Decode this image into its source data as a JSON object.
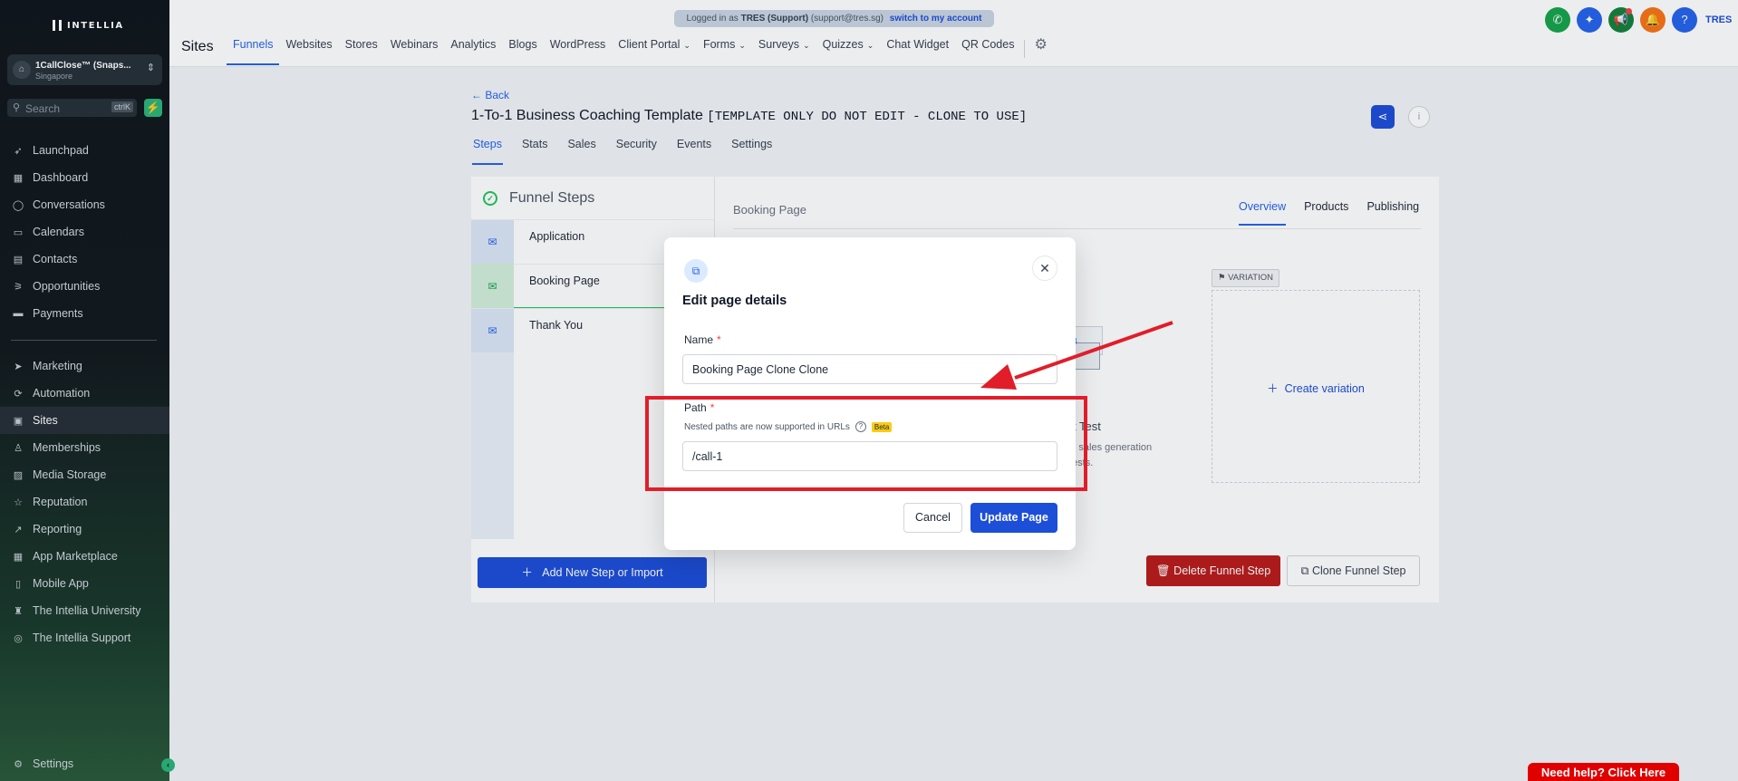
{
  "app": {
    "brand": "INTELLIA",
    "login_banner": {
      "prefix": "Logged in as",
      "user": "TRES (Support)",
      "email": "(support@tres.sg)",
      "switch_link": "switch to my account"
    }
  },
  "sidebar": {
    "account": {
      "name": "1CallClose™ (Snaps...",
      "location": "Singapore"
    },
    "search": {
      "placeholder": "Search",
      "shortcut": "ctrlK"
    },
    "items": [
      {
        "label": "Launchpad",
        "icon": "rocket-icon"
      },
      {
        "label": "Dashboard",
        "icon": "grid-icon"
      },
      {
        "label": "Conversations",
        "icon": "chat-icon"
      },
      {
        "label": "Calendars",
        "icon": "calendar-icon"
      },
      {
        "label": "Contacts",
        "icon": "contacts-icon"
      },
      {
        "label": "Opportunities",
        "icon": "filter-icon"
      },
      {
        "label": "Payments",
        "icon": "card-icon"
      }
    ],
    "items2": [
      {
        "label": "Marketing",
        "icon": "send-icon"
      },
      {
        "label": "Automation",
        "icon": "automation-icon"
      },
      {
        "label": "Sites",
        "icon": "globe-icon",
        "active": true
      },
      {
        "label": "Memberships",
        "icon": "membership-icon"
      },
      {
        "label": "Media Storage",
        "icon": "image-icon"
      },
      {
        "label": "Reputation",
        "icon": "star-icon"
      },
      {
        "label": "Reporting",
        "icon": "chart-icon"
      },
      {
        "label": "App Marketplace",
        "icon": "apps-icon"
      },
      {
        "label": "Mobile App",
        "icon": "phone-icon"
      },
      {
        "label": "The Intellia University",
        "icon": "graduation-icon"
      },
      {
        "label": "The Intellia Support",
        "icon": "support-icon"
      }
    ],
    "settings_label": "Settings"
  },
  "topbar": {
    "section_title": "Sites",
    "nav": [
      {
        "label": "Funnels",
        "active": true
      },
      {
        "label": "Websites"
      },
      {
        "label": "Stores"
      },
      {
        "label": "Webinars"
      },
      {
        "label": "Analytics"
      },
      {
        "label": "Blogs"
      },
      {
        "label": "WordPress"
      },
      {
        "label": "Client Portal",
        "dropdown": true
      },
      {
        "label": "Forms",
        "dropdown": true
      },
      {
        "label": "Surveys",
        "dropdown": true
      },
      {
        "label": "Quizzes",
        "dropdown": true
      },
      {
        "label": "Chat Widget"
      },
      {
        "label": "QR Codes"
      }
    ],
    "user_initials": "TRES",
    "icon_colors": {
      "phone": "#16a34a",
      "magic": "#2563eb",
      "announce": "#16a34a",
      "bell": "#f97316",
      "help": "#2563eb"
    }
  },
  "page": {
    "back_label": "Back",
    "title": "1-To-1 Business Coaching Template",
    "title_tag": "[TEMPLATE ONLY DO NOT EDIT - CLONE TO USE]",
    "tabs": [
      {
        "label": "Steps",
        "active": true
      },
      {
        "label": "Stats"
      },
      {
        "label": "Sales"
      },
      {
        "label": "Security"
      },
      {
        "label": "Events"
      },
      {
        "label": "Settings"
      }
    ]
  },
  "funnel_steps": {
    "header": "Funnel Steps",
    "steps": [
      {
        "label": "Application"
      },
      {
        "label": "Booking Page",
        "active": true
      },
      {
        "label": "Thank You"
      }
    ],
    "add_button": "Add New Step or Import"
  },
  "step_panel": {
    "title": "Booking Page",
    "tabs": [
      {
        "label": "Overview",
        "active": true
      },
      {
        "label": "Products"
      },
      {
        "label": "Publishing"
      }
    ],
    "ab_title": "A/B Split Test",
    "ab_title_visible": "blit Test",
    "ab_desc_line1": "and sales generation",
    "ab_desc_line2": "lit tests.",
    "variation_tag": "VARIATION",
    "create_variation": "Create variation",
    "delete_button": "Delete Funnel Step",
    "clone_button": "Clone Funnel Step"
  },
  "modal": {
    "title": "Edit page details",
    "name_label": "Name",
    "name_value": "Booking Page Clone Clone",
    "path_label": "Path",
    "path_help": "Nested paths are now supported in URLs",
    "beta_badge": "Beta",
    "path_value": "/call-1",
    "cancel_label": "Cancel",
    "update_label": "Update Page"
  },
  "need_help": "Need help? Click Here"
}
